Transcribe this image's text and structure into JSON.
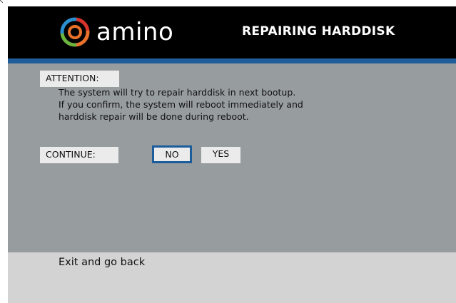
{
  "header": {
    "logo_text": "amino",
    "logo_icon": "amino-ring-logo",
    "title": "REPAIRING HARDDISK"
  },
  "attention": {
    "label": "ATTENTION:",
    "lines": [
      "The system will try to repair harddisk in next bootup.",
      "If you confirm, the system will reboot immediately and",
      "harddisk repair will be done during reboot."
    ]
  },
  "continue": {
    "label": "CONTINUE:",
    "options": [
      "NO",
      "YES"
    ],
    "selected": "NO"
  },
  "footer": {
    "exit_label": "Exit and go back"
  },
  "colors": {
    "header_bg": "#000000",
    "accent_rule": "#1f5e9a",
    "content_bg": "#979c9f",
    "footer_bg": "#d3d3d3",
    "focus_border": "#1b5d9b",
    "logo_orange": "#e8712b",
    "logo_red": "#d8342c",
    "logo_green": "#6db33f",
    "logo_blue": "#2a8fd0"
  }
}
